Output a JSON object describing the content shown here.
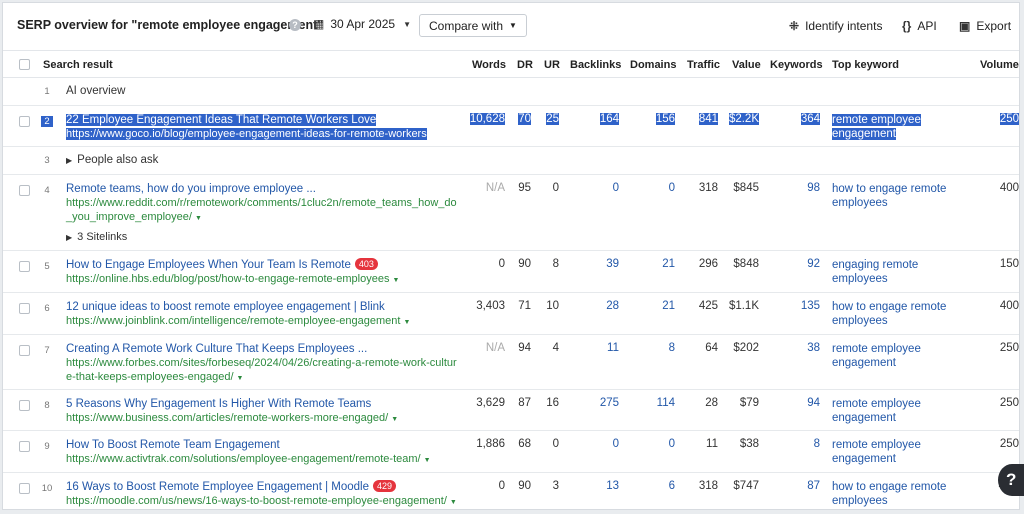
{
  "header": {
    "title": "SERP overview for \"remote employee engagement\"",
    "help": "?",
    "date": "30 Apr 2025",
    "compare_label": "Compare with",
    "identify_label": "Identify intents",
    "api_label": "API",
    "export_label": "Export"
  },
  "columns": {
    "search_result": "Search result",
    "words": "Words",
    "dr": "DR",
    "ur": "UR",
    "backlinks": "Backlinks",
    "domains": "Domains",
    "traffic": "Traffic",
    "value": "Value",
    "keywords": "Keywords",
    "top_keyword": "Top keyword",
    "volume": "Volume"
  },
  "rows": [
    {
      "num": "1",
      "label": "AI overview"
    },
    {
      "num": "2",
      "title": "22 Employee Engagement Ideas That Remote Workers Love",
      "url": "https://www.goco.io/blog/employee-engagement-ideas-for-remote-workers",
      "words": "10,628",
      "dr": "70",
      "ur": "25",
      "backlinks": "164",
      "domains": "156",
      "traffic": "841",
      "value": "$2.2K",
      "keywords": "364",
      "top_keyword": "remote employee engagement",
      "volume": "250"
    },
    {
      "num": "3",
      "label": "People also ask"
    },
    {
      "num": "4",
      "title": "Remote teams, how do you improve employee ...",
      "url": "https://www.reddit.com/r/remotework/comments/1cluc2n/remote_teams_how_do_you_improve_employee/",
      "sitelinks": "3 Sitelinks",
      "words": "N/A",
      "dr": "95",
      "ur": "0",
      "backlinks": "0",
      "domains": "0",
      "traffic": "318",
      "value": "$845",
      "keywords": "98",
      "top_keyword": "how to engage remote employees",
      "volume": "400"
    },
    {
      "num": "5",
      "title": "How to Engage Employees When Your Team Is Remote",
      "badge": "403",
      "url": "https://online.hbs.edu/blog/post/how-to-engage-remote-employees",
      "words": "0",
      "dr": "90",
      "ur": "8",
      "backlinks": "39",
      "domains": "21",
      "traffic": "296",
      "value": "$848",
      "keywords": "92",
      "top_keyword": "engaging remote employees",
      "volume": "150"
    },
    {
      "num": "6",
      "title": "12 unique ideas to boost remote employee engagement | Blink",
      "url": "https://www.joinblink.com/intelligence/remote-employee-engagement",
      "words": "3,403",
      "dr": "71",
      "ur": "10",
      "backlinks": "28",
      "domains": "21",
      "traffic": "425",
      "value": "$1.1K",
      "keywords": "135",
      "top_keyword": "how to engage remote employees",
      "volume": "400"
    },
    {
      "num": "7",
      "title": "Creating A Remote Work Culture That Keeps Employees ...",
      "url": "https://www.forbes.com/sites/forbeseq/2024/04/26/creating-a-remote-work-culture-that-keeps-employees-engaged/",
      "words": "N/A",
      "dr": "94",
      "ur": "4",
      "backlinks": "11",
      "domains": "8",
      "traffic": "64",
      "value": "$202",
      "keywords": "38",
      "top_keyword": "remote employee engagement",
      "volume": "250"
    },
    {
      "num": "8",
      "title": "5 Reasons Why Engagement Is Higher With Remote Teams",
      "url": "https://www.business.com/articles/remote-workers-more-engaged/",
      "words": "3,629",
      "dr": "87",
      "ur": "16",
      "backlinks": "275",
      "domains": "114",
      "traffic": "28",
      "value": "$79",
      "keywords": "94",
      "top_keyword": "remote employee engagement",
      "volume": "250"
    },
    {
      "num": "9",
      "title": "How To Boost Remote Team Engagement",
      "url": "https://www.activtrak.com/solutions/employee-engagement/remote-team/",
      "words": "1,886",
      "dr": "68",
      "ur": "0",
      "backlinks": "0",
      "domains": "0",
      "traffic": "11",
      "value": "$38",
      "keywords": "8",
      "top_keyword": "remote employee engagement",
      "volume": "250"
    },
    {
      "num": "10",
      "title": "16 Ways to Boost Remote Employee Engagement | Moodle",
      "badge": "429",
      "url": "https://moodle.com/us/news/16-ways-to-boost-remote-employee-engagement/",
      "words": "0",
      "dr": "90",
      "ur": "3",
      "backlinks": "13",
      "domains": "6",
      "traffic": "318",
      "value": "$747",
      "keywords": "87",
      "top_keyword": "how to engage remote employees",
      "volume": "4"
    }
  ],
  "colors": {
    "link": "#2257a8",
    "url": "#2c8a3e",
    "selection": "#2f62c9",
    "badge": "#e5343d"
  }
}
